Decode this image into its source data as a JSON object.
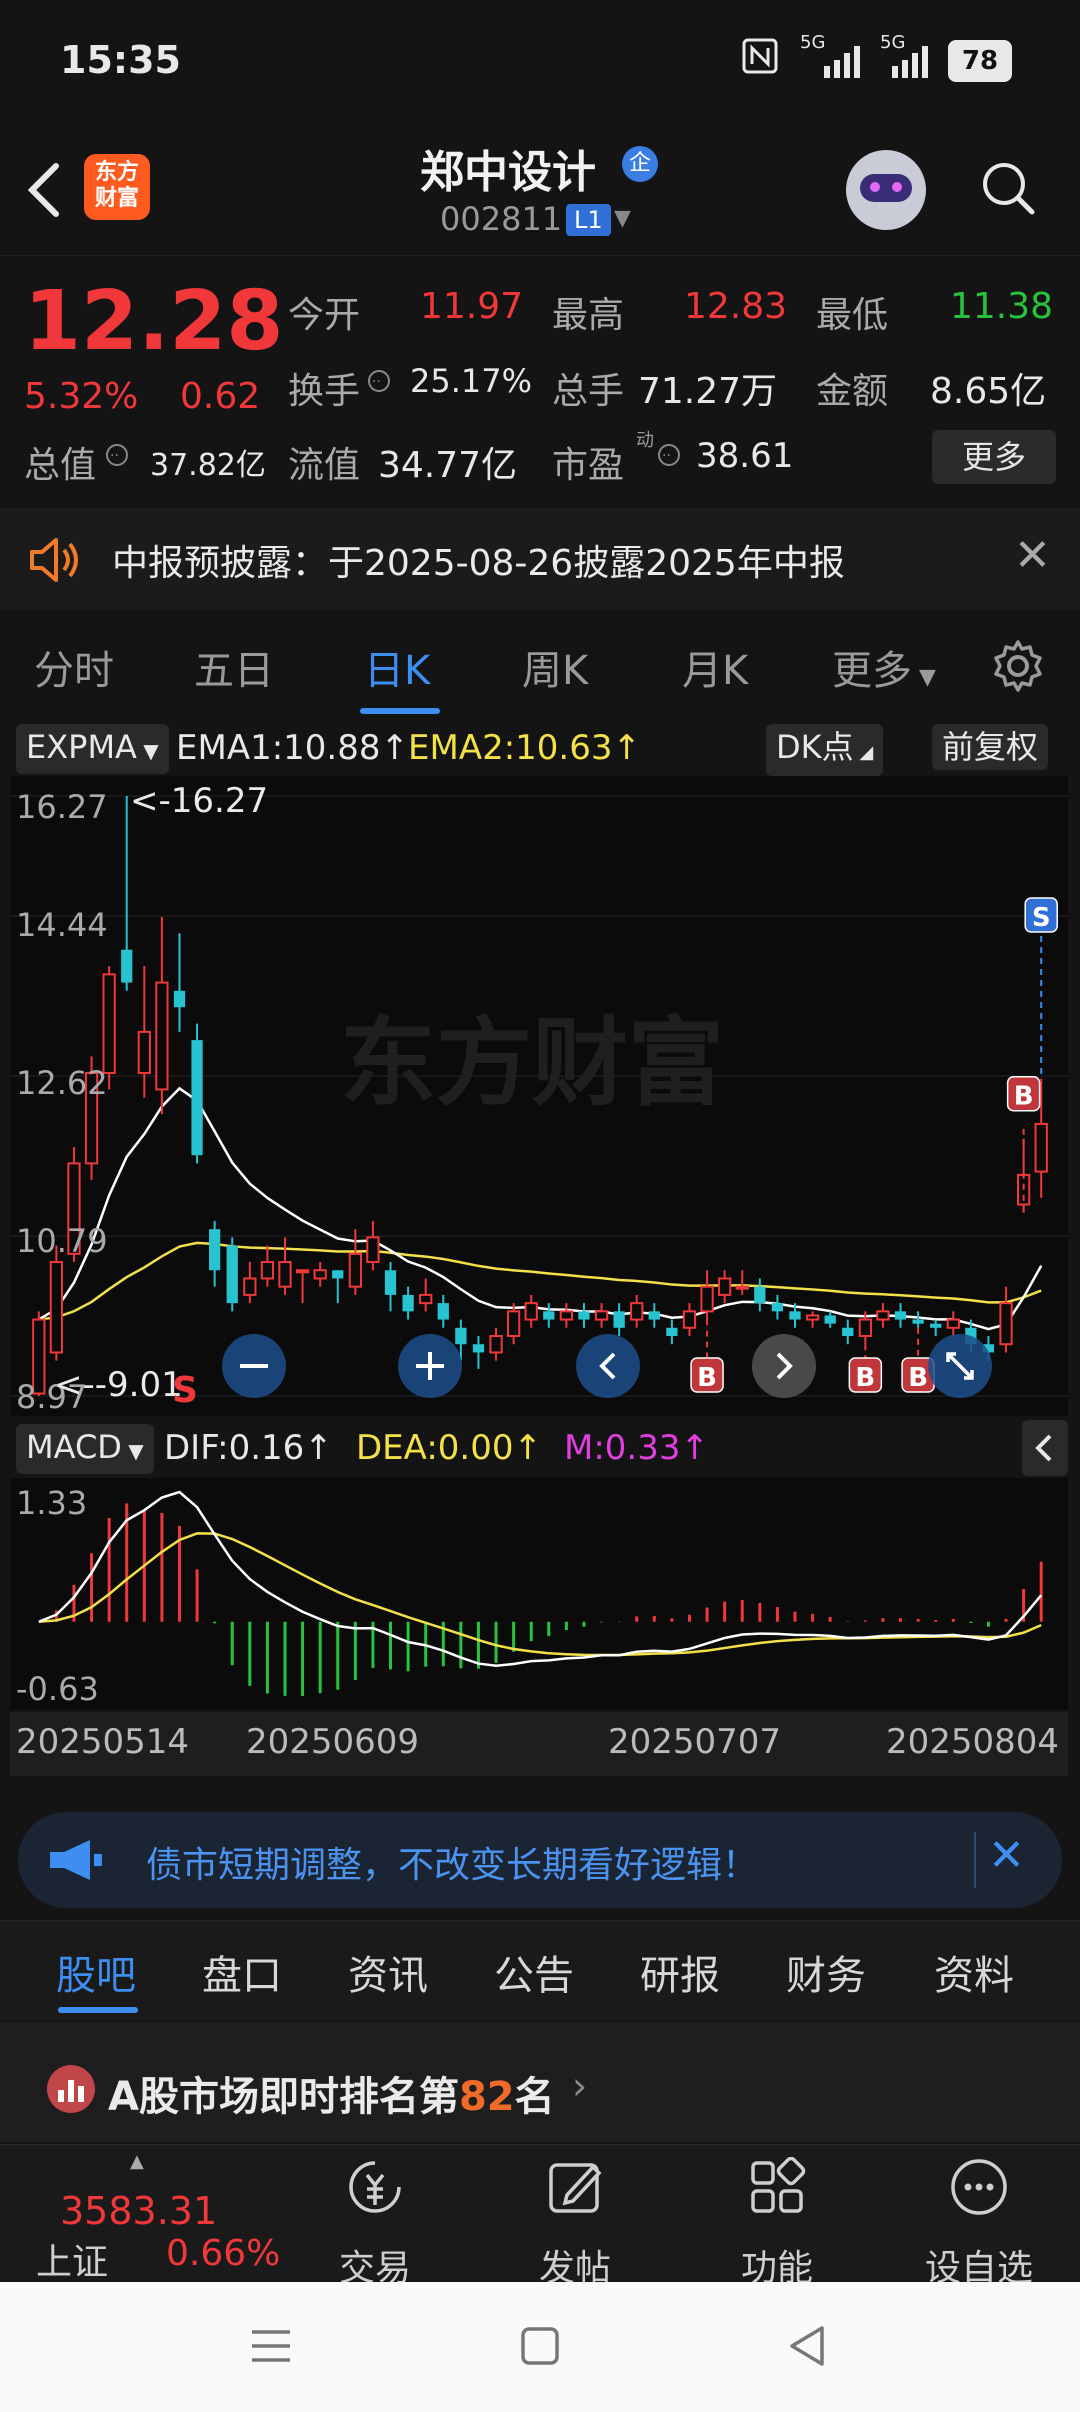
{
  "status_bar": {
    "time": "15:35",
    "net1": "5G",
    "net2": "5G",
    "battery": "78"
  },
  "header": {
    "app_logo_line1": "东方",
    "app_logo_line2": "财富",
    "stock_name": "郑中设计",
    "badge": "企",
    "stock_code": "002811",
    "level": "L1"
  },
  "quote": {
    "price": "12.28",
    "change_pct": "5.32%",
    "change_amt": "0.62",
    "open_label": "今开",
    "open": "11.97",
    "high_label": "最高",
    "high": "12.83",
    "low_label": "最低",
    "low": "11.38",
    "turnover_label": "换手",
    "turnover": "25.17%",
    "volume_label": "总手",
    "volume": "71.27万",
    "amount_label": "金额",
    "amount": "8.65亿",
    "mktcap_label": "总值",
    "mktcap": "37.82亿",
    "float_label": "流值",
    "float_cap": "34.77亿",
    "pe_label": "市盈",
    "pe_sup": "动",
    "pe": "38.61",
    "more": "更多"
  },
  "notice": {
    "text": "中报预披露：于2025-08-26披露2025年中报"
  },
  "period_tabs": [
    "分时",
    "五日",
    "日K",
    "周K",
    "月K",
    "更多"
  ],
  "active_period": 2,
  "kchart": {
    "indicator": "EXPMA",
    "ema1": "EMA1:10.88",
    "ema2": "EMA2:10.63",
    "arrow": "↑",
    "dk": "DK点",
    "adjust": "前复权",
    "y_labels": [
      "16.27",
      "14.44",
      "12.62",
      "10.79",
      "8.97"
    ],
    "max_marker": "<-16.27",
    "min_marker": "<--9.01",
    "sell_marker": "S",
    "buy_marker": "B",
    "watermark": "东方财富"
  },
  "macd": {
    "indicator": "MACD",
    "dif": "DIF:0.16",
    "dea": "DEA:0.00",
    "m": "M:0.33",
    "arrow": "↑",
    "y_top": "1.33",
    "y_bottom": "-0.63"
  },
  "dates": [
    "20250514",
    "20250609",
    "20250707",
    "20250804"
  ],
  "chart_data": {
    "type": "candlestick",
    "y_axis_labels": [
      16.27,
      14.44,
      12.62,
      10.79,
      8.97
    ],
    "x_labels": [
      "20250514",
      "20250609",
      "20250707",
      "20250804"
    ],
    "candles": [
      {
        "o": 9.0,
        "c": 9.9,
        "h": 10.0,
        "l": 8.97
      },
      {
        "o": 9.5,
        "c": 10.6,
        "h": 10.8,
        "l": 9.4
      },
      {
        "o": 10.7,
        "c": 11.8,
        "h": 12.0,
        "l": 10.6
      },
      {
        "o": 11.8,
        "c": 12.9,
        "h": 13.1,
        "l": 11.6
      },
      {
        "o": 12.9,
        "c": 14.1,
        "h": 14.2,
        "l": 12.7
      },
      {
        "o": 14.4,
        "c": 14.0,
        "h": 16.27,
        "l": 13.9
      },
      {
        "o": 12.9,
        "c": 13.4,
        "h": 14.2,
        "l": 12.6
      },
      {
        "o": 12.7,
        "c": 14.0,
        "h": 14.8,
        "l": 12.4
      },
      {
        "o": 13.9,
        "c": 13.7,
        "h": 14.6,
        "l": 13.4
      },
      {
        "o": 13.3,
        "c": 11.9,
        "h": 13.5,
        "l": 11.8
      },
      {
        "o": 11.0,
        "c": 10.5,
        "h": 11.1,
        "l": 10.3
      },
      {
        "o": 10.8,
        "c": 10.1,
        "h": 10.9,
        "l": 10.0
      },
      {
        "o": 10.2,
        "c": 10.4,
        "h": 10.6,
        "l": 10.1
      },
      {
        "o": 10.4,
        "c": 10.6,
        "h": 10.8,
        "l": 10.3
      },
      {
        "o": 10.3,
        "c": 10.6,
        "h": 10.9,
        "l": 10.2
      },
      {
        "o": 10.5,
        "c": 10.5,
        "h": 10.5,
        "l": 10.1
      },
      {
        "o": 10.4,
        "c": 10.5,
        "h": 10.6,
        "l": 10.3
      },
      {
        "o": 10.5,
        "c": 10.4,
        "h": 10.5,
        "l": 10.1
      },
      {
        "o": 10.3,
        "c": 10.7,
        "h": 11.0,
        "l": 10.2
      },
      {
        "o": 10.6,
        "c": 10.9,
        "h": 11.1,
        "l": 10.5
      },
      {
        "o": 10.5,
        "c": 10.2,
        "h": 10.6,
        "l": 10.0
      },
      {
        "o": 10.2,
        "c": 10.0,
        "h": 10.3,
        "l": 9.9
      },
      {
        "o": 10.1,
        "c": 10.2,
        "h": 10.4,
        "l": 10.0
      },
      {
        "o": 10.1,
        "c": 9.9,
        "h": 10.2,
        "l": 9.8
      },
      {
        "o": 9.8,
        "c": 9.6,
        "h": 9.9,
        "l": 9.4
      },
      {
        "o": 9.6,
        "c": 9.5,
        "h": 9.7,
        "l": 9.3
      },
      {
        "o": 9.5,
        "c": 9.7,
        "h": 9.8,
        "l": 9.4
      },
      {
        "o": 9.7,
        "c": 10.0,
        "h": 10.1,
        "l": 9.6
      },
      {
        "o": 9.9,
        "c": 10.1,
        "h": 10.2,
        "l": 9.8
      },
      {
        "o": 10.0,
        "c": 9.9,
        "h": 10.1,
        "l": 9.8
      },
      {
        "o": 9.9,
        "c": 10.0,
        "h": 10.1,
        "l": 9.8
      },
      {
        "o": 10.0,
        "c": 9.9,
        "h": 10.1,
        "l": 9.8
      },
      {
        "o": 9.9,
        "c": 10.0,
        "h": 10.1,
        "l": 9.8
      },
      {
        "o": 10.0,
        "c": 9.8,
        "h": 10.1,
        "l": 9.7
      },
      {
        "o": 9.9,
        "c": 10.1,
        "h": 10.2,
        "l": 9.8
      },
      {
        "o": 10.0,
        "c": 9.9,
        "h": 10.1,
        "l": 9.8
      },
      {
        "o": 9.8,
        "c": 9.7,
        "h": 9.9,
        "l": 9.6
      },
      {
        "o": 9.8,
        "c": 10.0,
        "h": 10.1,
        "l": 9.7
      },
      {
        "o": 10.0,
        "c": 10.3,
        "h": 10.5,
        "l": 9.9
      },
      {
        "o": 10.2,
        "c": 10.4,
        "h": 10.5,
        "l": 10.1
      },
      {
        "o": 10.3,
        "c": 10.3,
        "h": 10.5,
        "l": 10.2
      },
      {
        "o": 10.3,
        "c": 10.1,
        "h": 10.4,
        "l": 10.0
      },
      {
        "o": 10.1,
        "c": 10.0,
        "h": 10.2,
        "l": 9.9
      },
      {
        "o": 10.0,
        "c": 9.9,
        "h": 10.1,
        "l": 9.8
      },
      {
        "o": 9.9,
        "c": 9.95,
        "h": 10.0,
        "l": 9.8
      },
      {
        "o": 9.95,
        "c": 9.85,
        "h": 10.0,
        "l": 9.8
      },
      {
        "o": 9.8,
        "c": 9.7,
        "h": 9.9,
        "l": 9.6
      },
      {
        "o": 9.7,
        "c": 9.9,
        "h": 10.0,
        "l": 9.6
      },
      {
        "o": 9.9,
        "c": 10.0,
        "h": 10.1,
        "l": 9.8
      },
      {
        "o": 10.0,
        "c": 9.9,
        "h": 10.1,
        "l": 9.8
      },
      {
        "o": 9.9,
        "c": 9.85,
        "h": 10.0,
        "l": 9.8
      },
      {
        "o": 9.85,
        "c": 9.8,
        "h": 9.9,
        "l": 9.7
      },
      {
        "o": 9.8,
        "c": 9.9,
        "h": 10.0,
        "l": 9.7
      },
      {
        "o": 9.8,
        "c": 9.6,
        "h": 9.9,
        "l": 9.5
      },
      {
        "o": 9.6,
        "c": 9.5,
        "h": 9.7,
        "l": 9.4
      },
      {
        "o": 9.6,
        "c": 10.1,
        "h": 10.3,
        "l": 9.5
      },
      {
        "o": 11.3,
        "c": 11.66,
        "h": 12.1,
        "l": 11.2
      },
      {
        "o": 11.7,
        "c": 12.28,
        "h": 12.83,
        "l": 11.38
      }
    ],
    "buy_signal_indices": [
      38,
      47,
      50,
      56
    ],
    "sell_signal_indices": [
      57
    ]
  },
  "promo": {
    "text": "债市短期调整，不改变长期看好逻辑！"
  },
  "bottom_tabs": [
    "股吧",
    "盘口",
    "资讯",
    "公告",
    "研报",
    "财务",
    "资料"
  ],
  "active_bottom_tab": 0,
  "rank": {
    "prefix": "A股市场即时排名第",
    "num": "82",
    "suffix": "名"
  },
  "index_quote": {
    "value": "3583.31",
    "name": "上证",
    "pct": "0.66%"
  },
  "bottom_nav": [
    "交易",
    "发帖",
    "功能",
    "设自选"
  ],
  "colors": {
    "up": "#f0383b",
    "down": "#27c3d0",
    "accent": "#3d8ef0",
    "ema1": "#ffffff",
    "ema2": "#f3e14a"
  }
}
